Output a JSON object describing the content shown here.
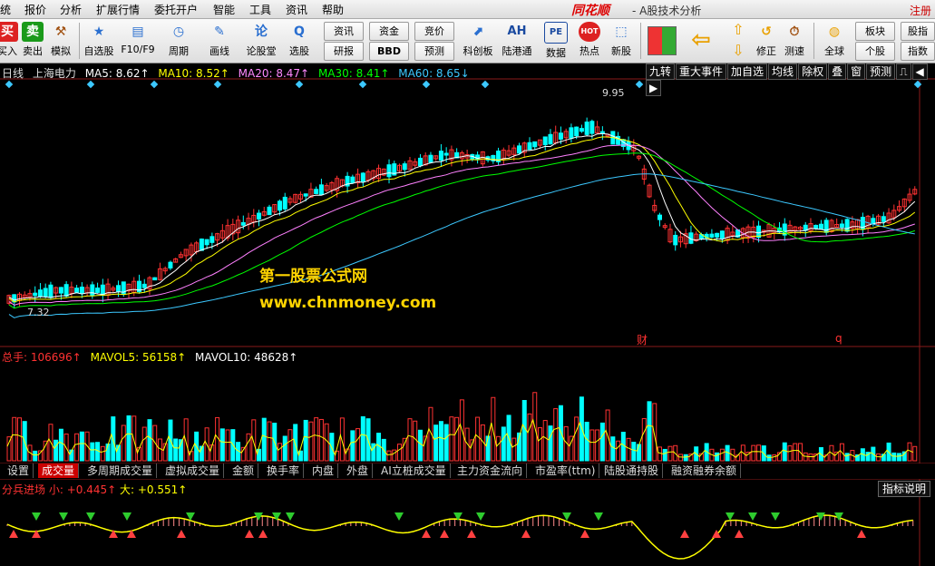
{
  "menu": [
    "统",
    "报价",
    "分析",
    "扩展行情",
    "委托开户",
    "智能",
    "工具",
    "资讯",
    "帮助"
  ],
  "brand": "同花顺",
  "app_title": "- A股技术分析",
  "register": "注册",
  "toolbar": {
    "buttons": [
      {
        "label": "买入",
        "glyph": "买"
      },
      {
        "label": "卖出",
        "glyph": "卖"
      },
      {
        "label": "模拟",
        "glyph": "⚒"
      },
      {
        "label": "自选股",
        "glyph": "★"
      },
      {
        "label": "F10/F9",
        "glyph": "▤"
      },
      {
        "label": "周期",
        "glyph": "◷"
      },
      {
        "label": "画线",
        "glyph": "✎"
      },
      {
        "label": "论股堂",
        "glyph": "论"
      },
      {
        "label": "选股",
        "glyph": "Q"
      },
      {
        "label": "科创板",
        "glyph": "⬈"
      },
      {
        "label": "陆港通",
        "glyph": "AH"
      },
      {
        "label": "数据",
        "glyph": "PE"
      },
      {
        "label": "热点",
        "glyph": "HOT"
      },
      {
        "label": "新股",
        "glyph": "⬚"
      },
      {
        "label": "修正",
        "glyph": "↺"
      },
      {
        "label": "测速",
        "glyph": "⏱"
      },
      {
        "label": "全球",
        "glyph": "◍"
      }
    ],
    "small_buttons": [
      "资讯",
      "研报",
      "资金",
      "BBD",
      "竞价",
      "预测",
      "板块",
      "个股",
      "股指",
      "指数"
    ]
  },
  "stock": {
    "period": "日线",
    "name": "上海电力",
    "ma5": "MA5: 8.62↑",
    "ma10": "MA10: 8.52↑",
    "ma20": "MA20: 8.47↑",
    "ma30": "MA30: 8.41↑",
    "ma60": "MA60: 8.65↓",
    "high_label": "9.95",
    "low_label": "7.32",
    "event_cai": "财",
    "event_q": "q"
  },
  "right_tabs": [
    "九转",
    "重大事件",
    "加自选",
    "均线",
    "除权",
    "叠",
    "窗",
    "预测"
  ],
  "watermark": {
    "line1": "第一股票公式网",
    "line2": "www.chnmoney.com"
  },
  "volume": {
    "total": "总手: 106696↑",
    "mavol5": "MAVOL5: 56158↑",
    "mavol10": "MAVOL10: 48628↑"
  },
  "bottom_tabs": [
    "设置",
    "成交量",
    "多周期成交量",
    "虚拟成交量",
    "金额",
    "换手率",
    "内盘",
    "外盘",
    "AI立桩成交量",
    "主力资金流向",
    "市盈率(ttm)",
    "陆股通持股",
    "融资融券余额"
  ],
  "indicator": {
    "name": "分兵进场",
    "small": "小: +0.445↑",
    "large": "大: +0.551↑",
    "help": "指标说明"
  },
  "colors": {
    "up": "#ff3232",
    "down": "#00ffff",
    "ma5": "#ffffff",
    "ma10": "#ffff00",
    "ma20": "#ff80ff",
    "ma30": "#00ff00",
    "ma60": "#3cc8ff",
    "watermark": "#ffd400"
  }
}
